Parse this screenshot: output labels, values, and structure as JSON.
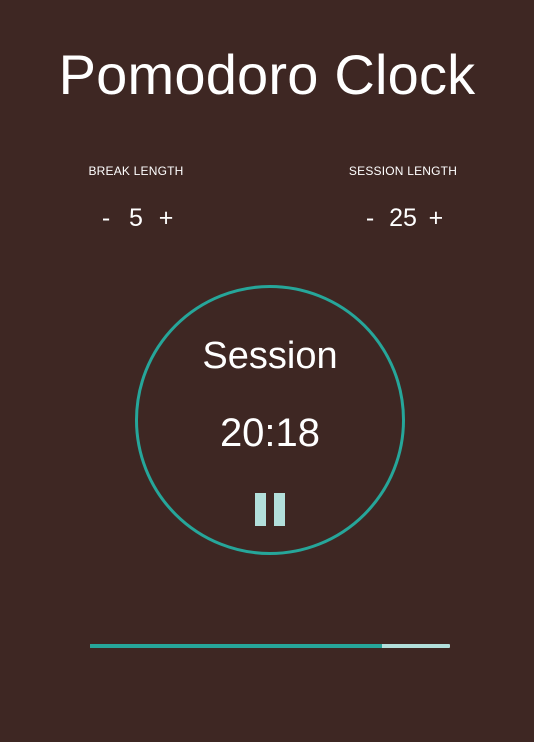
{
  "app": {
    "title": "Pomodoro Clock"
  },
  "settings": {
    "break": {
      "label": "BREAK LENGTH",
      "decrement": "-",
      "value": "5",
      "increment": "+"
    },
    "session": {
      "label": "SESSION LENGTH",
      "decrement": "-",
      "value": "25",
      "increment": "+"
    }
  },
  "timer": {
    "label": "Session",
    "time": "20:18",
    "control_icon": "pause-icon"
  },
  "progress": {
    "fraction": 0.812
  },
  "colors": {
    "background": "#3e2723",
    "accent": "#26a69a",
    "accent_light": "#b2dfdb",
    "text": "#ffffff"
  }
}
